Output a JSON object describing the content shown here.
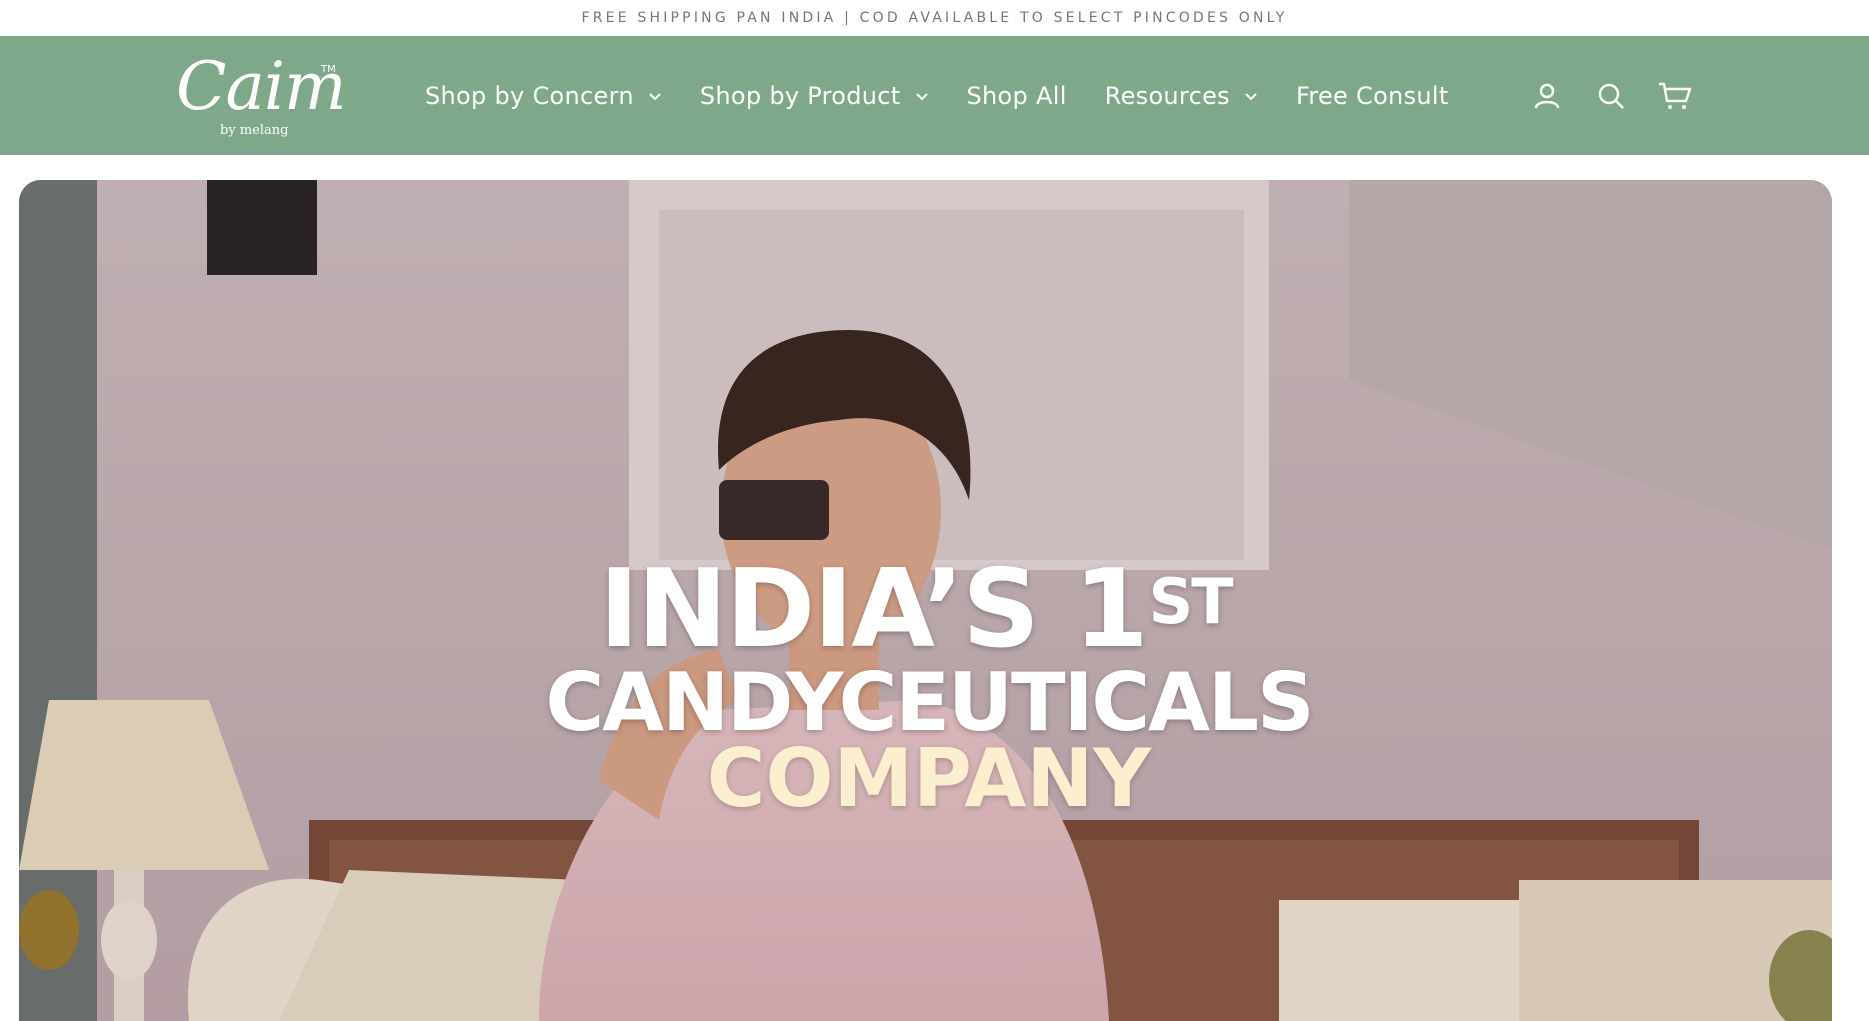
{
  "announcement": {
    "text": "FREE SHIPPING PAN INDIA | COD AVAILABLE TO SELECT PINCODES ONLY"
  },
  "header": {
    "logo": {
      "wordmark": "Caim",
      "trademark": "TM",
      "sub": "by melang"
    },
    "nav": [
      {
        "label": "Shop by Concern",
        "has_dropdown": true
      },
      {
        "label": "Shop by Product",
        "has_dropdown": true
      },
      {
        "label": "Shop All",
        "has_dropdown": false
      },
      {
        "label": "Resources",
        "has_dropdown": true
      },
      {
        "label": "Free Consult",
        "has_dropdown": false
      }
    ],
    "icons": [
      "account-icon",
      "search-icon",
      "cart-icon"
    ]
  },
  "hero": {
    "line1": "INDIA’S 1",
    "line1_sup": "ST",
    "line2": "CANDYCEUTICALS",
    "line3": "COMPANY"
  },
  "colors": {
    "header_bg": "#7fa88b",
    "announcement_text": "#6f7a73",
    "hero_highlight": "#fbefcf"
  }
}
